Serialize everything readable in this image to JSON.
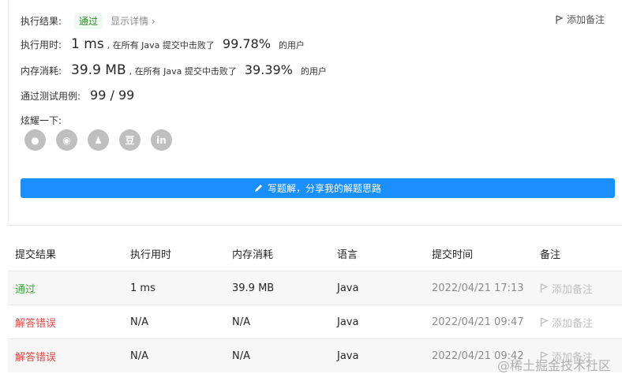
{
  "summary": {
    "result_label": "执行结果:",
    "result_badge": "通过",
    "details_link": "显示详情 ›",
    "add_note": "添加备注",
    "time_label": "执行用时:",
    "time_value": "1 ms",
    "time_text": ", 在所有 Java 提交中击败了",
    "time_pct": "99.78%",
    "time_suffix": "的用户",
    "mem_label": "内存消耗:",
    "mem_value": "39.9 MB",
    "mem_text": ", 在所有 Java 提交中击败了",
    "mem_pct": "39.39%",
    "mem_suffix": "的用户",
    "tests_label": "通过测试用例:",
    "tests_value": "99 / 99",
    "share_label": "炫耀一下:",
    "share_icons": [
      {
        "name": "wechat-icon",
        "glyph": "●"
      },
      {
        "name": "weibo-icon",
        "glyph": "◉"
      },
      {
        "name": "qq-icon",
        "glyph": "♟"
      },
      {
        "name": "douban-icon",
        "glyph": "豆"
      },
      {
        "name": "linkedin-icon",
        "glyph": "in"
      }
    ],
    "write_button": "写题解，分享我的解题思路"
  },
  "table": {
    "headers": [
      "提交结果",
      "执行用时",
      "内存消耗",
      "语言",
      "提交时间",
      "备注"
    ],
    "rows": [
      {
        "result": "通过",
        "time": "1 ms",
        "memory": "39.9 MB",
        "lang": "Java",
        "submitted": "2022/04/21 17:13",
        "note": "添加备注",
        "status": "ok"
      },
      {
        "result": "解答错误",
        "time": "N/A",
        "memory": "N/A",
        "lang": "Java",
        "submitted": "2022/04/21 09:47",
        "note": "添加备注",
        "status": "err"
      },
      {
        "result": "解答错误",
        "time": "N/A",
        "memory": "N/A",
        "lang": "Java",
        "submitted": "2022/04/21 09:42",
        "note": "添加备注",
        "status": "err"
      }
    ]
  },
  "watermark": "@稀土掘金技术社区",
  "colors": {
    "accent": "#1a90ff",
    "success": "#3aa83a",
    "error": "#e04a4a"
  }
}
